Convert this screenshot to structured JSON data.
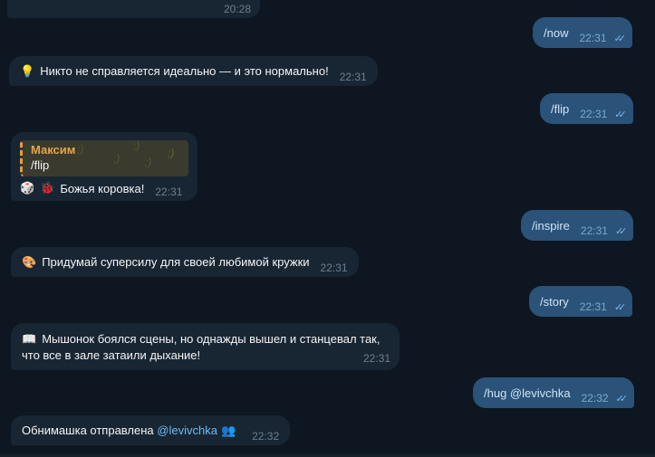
{
  "messages": [
    {
      "dir": "in",
      "time": "20:28"
    },
    {
      "dir": "out",
      "text": "/now",
      "time": "22:31"
    },
    {
      "dir": "in",
      "icon": "lightbulb-icon",
      "text": "Никто не справляется идеально — и это нормально!",
      "time": "22:31"
    },
    {
      "dir": "out",
      "text": "/flip",
      "time": "22:31"
    },
    {
      "dir": "in",
      "reply": {
        "author": "Максим",
        "text": "/flip"
      },
      "text": "Божья коровка!",
      "time": "22:31"
    },
    {
      "dir": "out",
      "text": "/inspire",
      "time": "22:31"
    },
    {
      "dir": "in",
      "text": "Придумай суперсилу для своей любимой кружки",
      "time": "22:31"
    },
    {
      "dir": "out",
      "text": "/story",
      "time": "22:31"
    },
    {
      "dir": "in",
      "text_line1": "Мышонок боялся сцены, но однажды вышел и станцевал так,",
      "text_line2": "что все в зале затаили дыхание!",
      "time": "22:31"
    },
    {
      "dir": "out",
      "text": "/hug @levivchka",
      "time": "22:32"
    },
    {
      "dir": "in",
      "text": "Обнимашка отправлена",
      "mention": "@levivchka",
      "time": "22:32"
    }
  ],
  "check": "✓✓",
  "smile": ";)"
}
